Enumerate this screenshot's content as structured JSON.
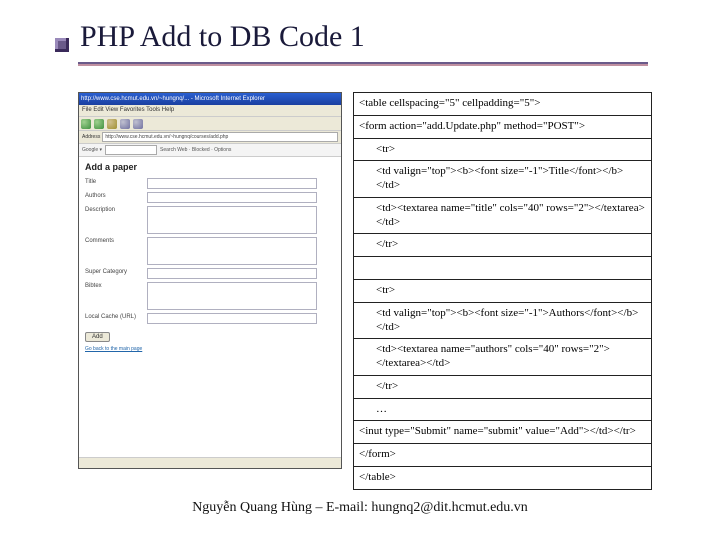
{
  "slide": {
    "title": "PHP Add to DB Code 1",
    "footer": "Nguyễn Quang Hùng – E-mail: hungnq2@dit.hcmut.edu.vn"
  },
  "browser": {
    "titlebar": "http://www.cse.hcmut.edu.vn/~hungnq/... - Microsoft Internet Explorer",
    "menu": "File   Edit   View   Favorites   Tools   Help",
    "address_label": "Address",
    "address_value": "http://www.cse.hcmut.edu.vn/~hungnq/courses/add.php",
    "google_label": "Google ▾",
    "google_hint": "Search Web  ·  Blocked  ·  Options"
  },
  "form": {
    "heading": "Add a paper",
    "labels": {
      "title": "Title",
      "authors": "Authors",
      "description": "Description",
      "comments": "Comments",
      "supercat": "Super Category",
      "bibtex": "Bibtex",
      "url": "Local Cache (URL)"
    },
    "submit": "Add",
    "back": "Go back to the main page"
  },
  "code": {
    "l1": "<table cellspacing=\"5\" cellpadding=\"5\">",
    "l2": "<form action=\"add.Update.php\"  method=\"POST\">",
    "l3": "<tr>",
    "l4": "<td valign=\"top\"><b><font size=\"-1\">Title</font></b></td>",
    "l5": "<td><textarea name=\"title\" cols=\"40\" rows=\"2\"></textarea></td>",
    "l6": "</tr>",
    "l7": "<tr>",
    "l8": "<td valign=\"top\"><b><font size=\"-1\">Authors</font></b></td>",
    "l9": "<td><textarea name=\"authors\" cols=\"40\" rows=\"2\"></textarea></td>",
    "l10": "</tr>",
    "l11": "…",
    "l12": "<inut type=\"Submit\" name=\"submit\" value=\"Add\"></td></tr>",
    "l13": "</form>",
    "l14": "</table>"
  }
}
